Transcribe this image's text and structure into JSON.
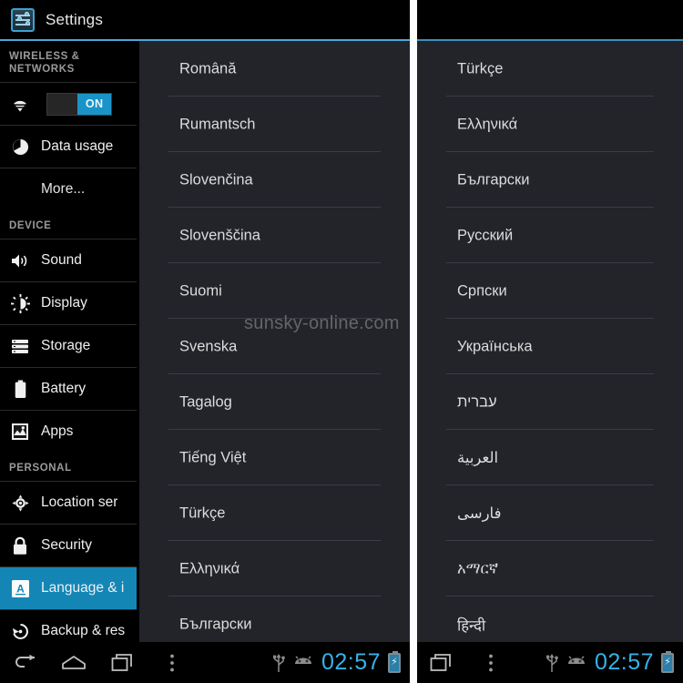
{
  "app": {
    "title": "Settings",
    "icon": "settings-sliders-icon",
    "accent_color": "#4aa8d8",
    "selected_color": "#1386b6",
    "list_bg_color": "#22242a"
  },
  "watermark": {
    "text": "sunsky-online.com"
  },
  "sidebar": {
    "sections": [
      {
        "header": "WIRELESS & NETWORKS",
        "items": [
          {
            "label": "",
            "icon": "wifi-icon",
            "type": "toggle",
            "toggle_label": "ON",
            "toggle_state": "on"
          },
          {
            "label": "Data usage",
            "icon": "data-usage-pie-icon",
            "type": "row"
          },
          {
            "label": "More...",
            "icon": "",
            "type": "more"
          }
        ]
      },
      {
        "header": "DEVICE",
        "items": [
          {
            "label": "Sound",
            "icon": "speaker-volume-icon",
            "type": "row"
          },
          {
            "label": "Display",
            "icon": "brightness-icon",
            "type": "row"
          },
          {
            "label": "Storage",
            "icon": "storage-disks-icon",
            "type": "row"
          },
          {
            "label": "Battery",
            "icon": "battery-icon",
            "type": "row"
          },
          {
            "label": "Apps",
            "icon": "apps-image-icon",
            "type": "row"
          }
        ]
      },
      {
        "header": "PERSONAL",
        "items": [
          {
            "label": "Location ser",
            "icon": "location-target-icon",
            "type": "row"
          },
          {
            "label": "Security",
            "icon": "lock-icon",
            "type": "row"
          },
          {
            "label": "Language & i",
            "icon": "language-a-icon",
            "type": "row",
            "selected": true
          },
          {
            "label": "Backup & res",
            "icon": "backup-restore-icon",
            "type": "row"
          }
        ]
      }
    ]
  },
  "language_list_left": {
    "items": [
      {
        "label": "Română",
        "rtl": false
      },
      {
        "label": "Rumantsch",
        "rtl": false
      },
      {
        "label": "Slovenčina",
        "rtl": false
      },
      {
        "label": "Slovenščina",
        "rtl": false
      },
      {
        "label": "Suomi",
        "rtl": false
      },
      {
        "label": "Svenska",
        "rtl": false
      },
      {
        "label": "Tagalog",
        "rtl": false
      },
      {
        "label": "Tiếng Việt",
        "rtl": false
      },
      {
        "label": "Türkçe",
        "rtl": false
      },
      {
        "label": "Ελληνικά",
        "rtl": false
      },
      {
        "label": "Български",
        "rtl": false
      }
    ]
  },
  "language_list_right": {
    "items": [
      {
        "label": "Türkçe",
        "rtl": false
      },
      {
        "label": "Ελληνικά",
        "rtl": false
      },
      {
        "label": "Български",
        "rtl": false
      },
      {
        "label": "Русский",
        "rtl": false
      },
      {
        "label": "Српски",
        "rtl": false
      },
      {
        "label": "Українська",
        "rtl": false
      },
      {
        "label": "עברית",
        "rtl": true
      },
      {
        "label": "العربية",
        "rtl": true
      },
      {
        "label": "فارسی",
        "rtl": true
      },
      {
        "label": "አማርኛ",
        "rtl": false
      },
      {
        "label": "हिन्दी",
        "rtl": false
      }
    ]
  },
  "navbar_left": {
    "buttons": [
      {
        "icon": "back-arrow-icon"
      },
      {
        "icon": "home-icon"
      },
      {
        "icon": "recent-apps-icon"
      },
      {
        "icon": "overflow-menu-icon"
      }
    ],
    "status": {
      "usb_icon": "usb-icon",
      "android_icon": "android-debug-icon",
      "clock": "02:57",
      "battery_icon": "battery-charging-icon",
      "battery_glyph": "⚡"
    }
  },
  "navbar_right": {
    "buttons": [
      {
        "icon": "recent-apps-icon"
      },
      {
        "icon": "overflow-menu-icon"
      }
    ],
    "status": {
      "usb_icon": "usb-icon",
      "android_icon": "android-debug-icon",
      "clock": "02:57",
      "battery_icon": "battery-charging-icon",
      "battery_glyph": "⚡"
    }
  }
}
